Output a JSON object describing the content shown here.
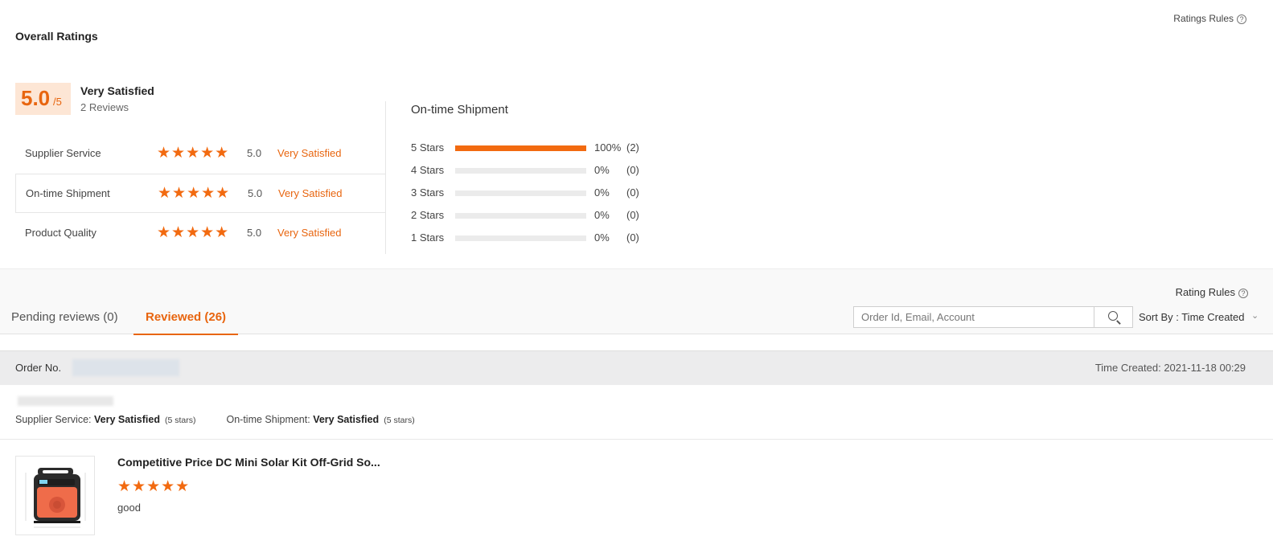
{
  "header": {
    "title": "Overall Ratings",
    "ratings_rules": "Ratings Rules"
  },
  "overall": {
    "score": "5.0",
    "score_max": "/5",
    "label": "Very Satisfied",
    "reviews": "2 Reviews"
  },
  "categories": [
    {
      "label": "Supplier Service",
      "stars": 5,
      "value": "5.0",
      "satisfaction": "Very Satisfied"
    },
    {
      "label": "On-time Shipment",
      "stars": 5,
      "value": "5.0",
      "satisfaction": "Very Satisfied"
    },
    {
      "label": "Product Quality",
      "stars": 5,
      "value": "5.0",
      "satisfaction": "Very Satisfied"
    }
  ],
  "distribution": {
    "title": "On-time Shipment",
    "rows": [
      {
        "label": "5  Stars",
        "percent": "100%",
        "count": "(2)",
        "fraction": 1.0
      },
      {
        "label": "4  Stars",
        "percent": "0%",
        "count": "(0)",
        "fraction": 0
      },
      {
        "label": "3  Stars",
        "percent": "0%",
        "count": "(0)",
        "fraction": 0
      },
      {
        "label": "2  Stars",
        "percent": "0%",
        "count": "(0)",
        "fraction": 0
      },
      {
        "label": "1  Stars",
        "percent": "0%",
        "count": "(0)",
        "fraction": 0
      }
    ]
  },
  "reviews_section": {
    "rating_rules": "Rating Rules",
    "tabs": [
      {
        "label": "Pending reviews (0)",
        "active": false
      },
      {
        "label": "Reviewed (26)",
        "active": true
      }
    ],
    "search_placeholder": "Order Id, Email, Account",
    "sort_label": "Sort By : Time Created"
  },
  "order": {
    "order_no_label": "Order No.",
    "time_created": "Time Created: 2021-11-18 00:29",
    "supplier_service_label": "Supplier Service:",
    "supplier_service_value": "Very Satisfied",
    "supplier_service_stars": "(5 stars)",
    "shipment_label": "On-time Shipment:",
    "shipment_value": "Very Satisfied",
    "shipment_stars": "(5 stars)"
  },
  "product": {
    "title": "Competitive Price DC Mini Solar Kit Off-Grid So...",
    "stars": 5,
    "comment": "good"
  },
  "colors": {
    "accent": "#e8650f",
    "star": "#f26a10",
    "score_bg": "#fde6d5"
  }
}
